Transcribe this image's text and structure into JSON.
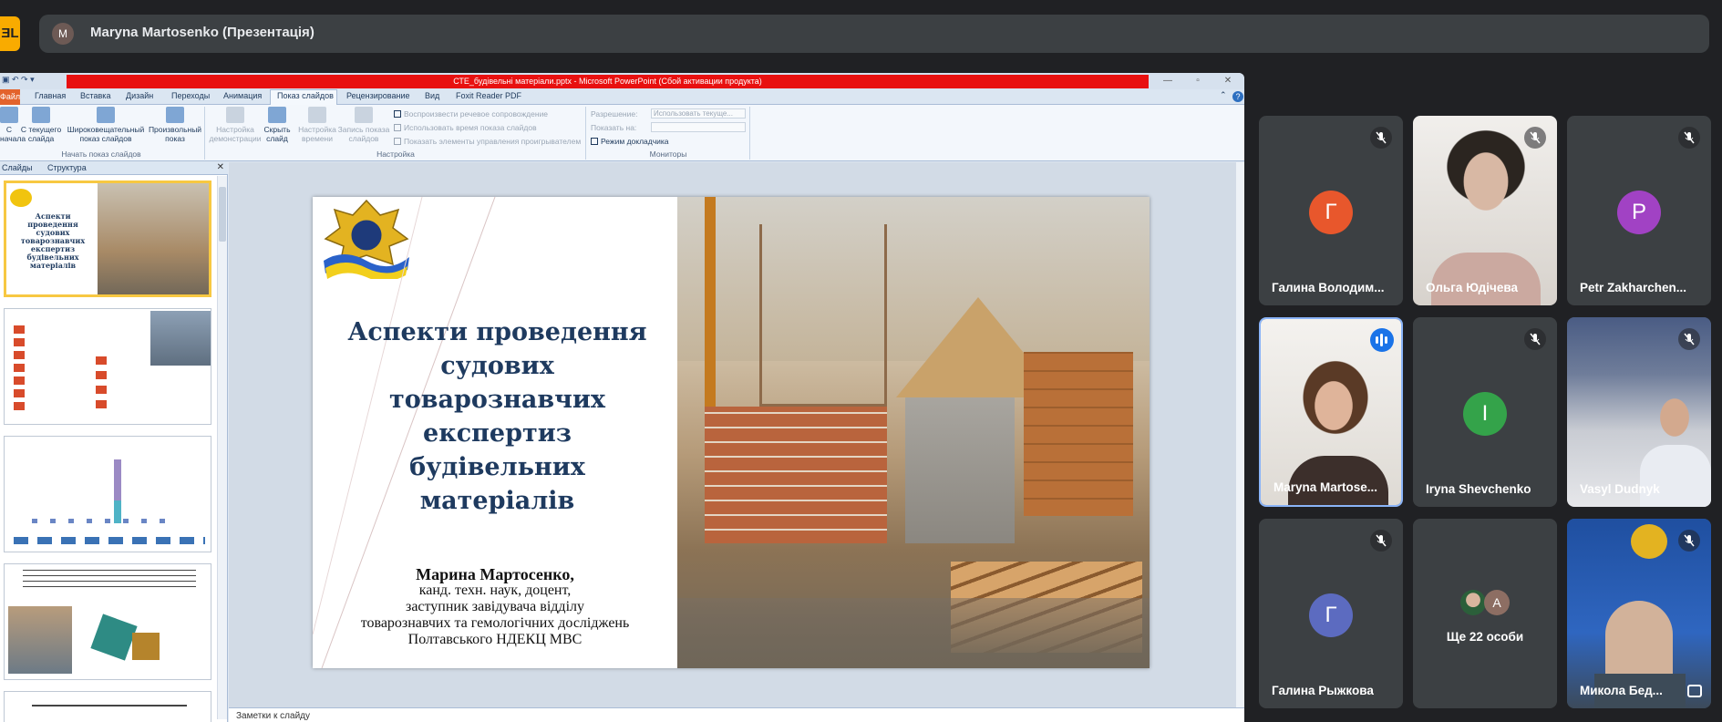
{
  "app": {
    "logo_text": "ƎL"
  },
  "presenter": {
    "avatar_letter": "M",
    "label": "Maryna Martosenko (Презентація)"
  },
  "ppt": {
    "window_title": "СТЕ_будівельні матеріали.pptx  -  Microsoft PowerPoint (Сбой активации продукта)",
    "tabs": [
      "Файл",
      "Главная",
      "Вставка",
      "Дизайн",
      "Переходы",
      "Анимация",
      "Показ слайдов",
      "Рецензирование",
      "Вид",
      "Foxit Reader PDF"
    ],
    "ribbon": {
      "btn_from_start": "С\nначала",
      "btn_from_current": "С текущего\nслайда",
      "btn_broadcast": "Широковещательный\nпоказ слайдов",
      "btn_custom": "Произвольный\nпоказ",
      "btn_setup": "Настройка\nдемонстрации",
      "btn_hide": "Скрыть\nслайд",
      "btn_rehearse": "Настройка\nвремени",
      "btn_record": "Запись показа\nслайдов",
      "chk_narration": "Воспроизвести речевое сопровождение",
      "chk_timings": "Использовать время показа слайдов",
      "chk_controls": "Показать элементы управления проигрывателем",
      "resolution_label": "Разрешение:",
      "resolution_value": "Использовать текуще...",
      "show_on_label": "Показать на:",
      "presenter_view": "Режим докладчика",
      "group_start": "Начать показ слайдов",
      "group_setup": "Настройка",
      "group_monitors": "Мониторы"
    },
    "pane_tabs": {
      "slides": "Слайды",
      "outline": "Структура"
    },
    "thumb_numbers": [
      "1",
      "2",
      "3",
      "4",
      "5"
    ],
    "slide": {
      "title": "Аспекти проведення судових товарознавчих експертиз будівельних матеріалів",
      "author_name": "Марина Мартосенко,",
      "author_line1": "канд. техн. наук, доцент,",
      "author_line2": "заступник завідувача відділу",
      "author_line3": "товарознавчих та гемологічних досліджень",
      "author_line4": "Полтавського НДЕКЦ МВС"
    },
    "notes_placeholder": "Заметки к слайду"
  },
  "participants": [
    {
      "name": "Галина Володим...",
      "letter": "Г",
      "color": "#e8572c",
      "muted": true
    },
    {
      "name": "Ольга Юдічева",
      "letter": "",
      "color": "",
      "muted": true
    },
    {
      "name": "Petr Zakharchen...",
      "letter": "P",
      "color": "#a142c4",
      "muted": true
    },
    {
      "name": "Maryna Martose...",
      "letter": "",
      "color": "",
      "muted": false,
      "speaking": true
    },
    {
      "name": "Iryna Shevchenko",
      "letter": "I",
      "color": "#34a34a",
      "muted": true
    },
    {
      "name": "Vasyl Dudnyk",
      "letter": "",
      "color": "",
      "muted": true
    },
    {
      "name": "Галина Рыжкова",
      "letter": "Г",
      "color": "#5c6bc0",
      "muted": true
    },
    {
      "name": "Ще 22 особи",
      "letter": "",
      "color": "",
      "muted": false
    },
    {
      "name": "Микола Бед...",
      "letter": "",
      "color": "",
      "muted": true
    }
  ],
  "more_avatar_letter": "А"
}
